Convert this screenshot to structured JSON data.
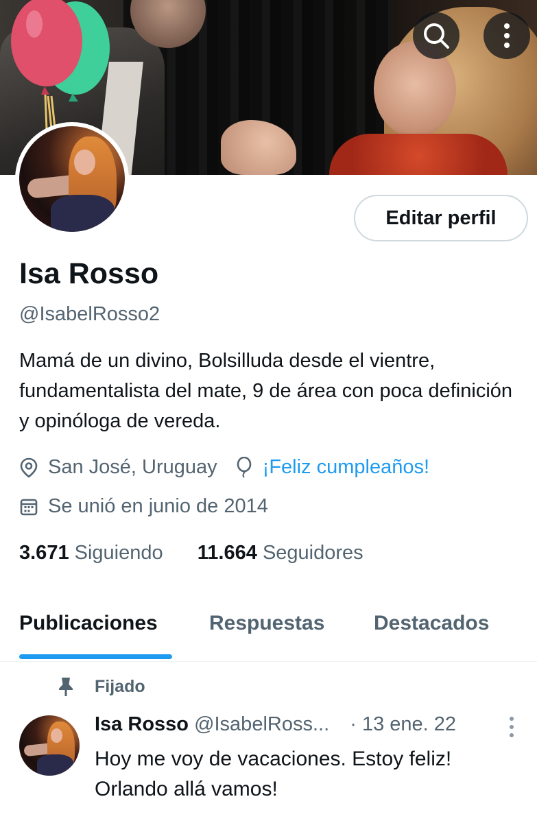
{
  "header": {
    "search_icon": "search-icon",
    "more_icon": "more-vertical-icon"
  },
  "profile": {
    "edit_button": "Editar perfil",
    "name": "Isa Rosso",
    "handle": "@IsabelRosso2",
    "bio": "Mamá de un divino, Bolsilluda desde el vientre, fundamentalista del mate, 9 de área con poca definición y opinóloga de vereda.",
    "location": "San José, Uruguay",
    "birthday": "¡Feliz cumpleaños!",
    "joined": "Se unió en junio de 2014",
    "following_count": "3.671",
    "following_label": "Siguiendo",
    "followers_count": "11.664",
    "followers_label": "Seguidores"
  },
  "tabs": [
    {
      "label": "Publicaciones",
      "active": true
    },
    {
      "label": "Respuestas",
      "active": false
    },
    {
      "label": "Destacados",
      "active": false
    }
  ],
  "pinned_post": {
    "pinned_label": "Fijado",
    "author_name": "Isa Rosso",
    "author_handle": "@IsabelRoss...",
    "date": "· 13 ene. 22",
    "text": "Hoy me voy de vacaciones. Estoy feliz! Orlando allá vamos!"
  },
  "colors": {
    "accent": "#1d9bf0",
    "text_primary": "#0f1419",
    "text_secondary": "#536471",
    "balloon_red": "#e0506a",
    "balloon_green": "#3fcf9a"
  }
}
